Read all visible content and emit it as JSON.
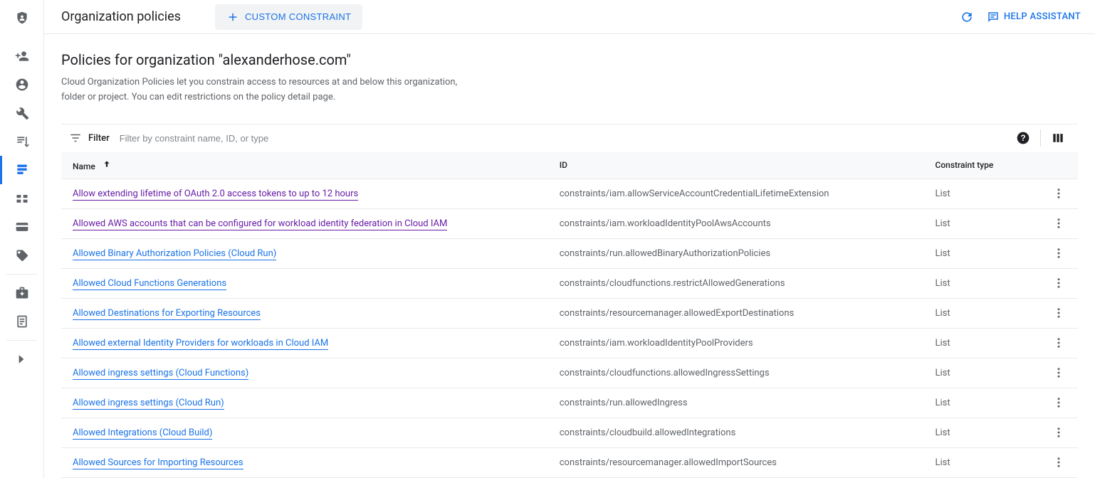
{
  "header": {
    "title": "Organization policies",
    "custom_constraint_label": "CUSTOM CONSTRAINT",
    "help_assistant_label": "HELP ASSISTANT"
  },
  "subtitle": "Policies for organization \"alexanderhose.com\"",
  "description": "Cloud Organization Policies let you constrain access to resources at and below this organization, folder or project. You can edit restrictions on the policy detail page.",
  "filter": {
    "label": "Filter",
    "placeholder": "Filter by constraint name, ID, or type"
  },
  "table": {
    "columns": {
      "name": "Name",
      "id": "ID",
      "constraint_type": "Constraint type"
    },
    "rows": [
      {
        "name": "Allow extending lifetime of OAuth 2.0 access tokens to up to 12 hours",
        "id": "constraints/iam.allowServiceAccountCredentialLifetimeExtension",
        "type": "List",
        "visited": true
      },
      {
        "name": "Allowed AWS accounts that can be configured for workload identity federation in Cloud IAM",
        "id": "constraints/iam.workloadIdentityPoolAwsAccounts",
        "type": "List",
        "visited": true
      },
      {
        "name": "Allowed Binary Authorization Policies (Cloud Run)",
        "id": "constraints/run.allowedBinaryAuthorizationPolicies",
        "type": "List",
        "visited": false
      },
      {
        "name": "Allowed Cloud Functions Generations",
        "id": "constraints/cloudfunctions.restrictAllowedGenerations",
        "type": "List",
        "visited": false
      },
      {
        "name": "Allowed Destinations for Exporting Resources",
        "id": "constraints/resourcemanager.allowedExportDestinations",
        "type": "List",
        "visited": false
      },
      {
        "name": "Allowed external Identity Providers for workloads in Cloud IAM",
        "id": "constraints/iam.workloadIdentityPoolProviders",
        "type": "List",
        "visited": false
      },
      {
        "name": "Allowed ingress settings (Cloud Functions)",
        "id": "constraints/cloudfunctions.allowedIngressSettings",
        "type": "List",
        "visited": false
      },
      {
        "name": "Allowed ingress settings (Cloud Run)",
        "id": "constraints/run.allowedIngress",
        "type": "List",
        "visited": false
      },
      {
        "name": "Allowed Integrations (Cloud Build)",
        "id": "constraints/cloudbuild.allowedIntegrations",
        "type": "List",
        "visited": false
      },
      {
        "name": "Allowed Sources for Importing Resources",
        "id": "constraints/resourcemanager.allowedImportSources",
        "type": "List",
        "visited": false
      }
    ]
  }
}
